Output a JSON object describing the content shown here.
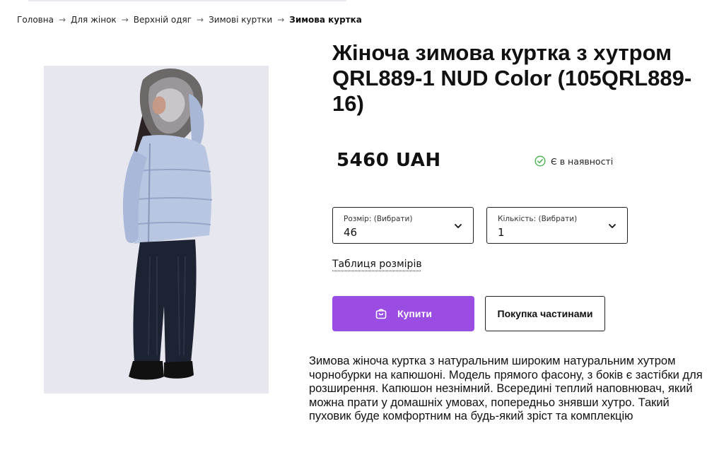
{
  "breadcrumb": {
    "items": [
      "Головна",
      "Для жінок",
      "Верхній одяг",
      "Зимові куртки"
    ],
    "current": "Зимова куртка",
    "separator": "→"
  },
  "product": {
    "title": "Жіноча зимова куртка з хутром QRL889-1 NUD Color (105QRL889-16)",
    "price": "5460 UAH",
    "stock_status": "Є в наявності",
    "image_icon": "product-photo"
  },
  "size_select": {
    "label": "Розмір: (Вибрати)",
    "value": "46"
  },
  "quantity_select": {
    "label": "Кількість: (Вибрати)",
    "value": "1"
  },
  "size_table_link": "Таблиця розмірів",
  "buttons": {
    "buy": "Купити",
    "installments": "Покупка частинами"
  },
  "description": "Зимова жіноча куртка з натуральним широким натуральним хутром чорнобурки на капюшоні. Модель прямого фасону, з боків є застібки для розширення. Капюшон незнімний.  Всередині теплий наповнювач, який можна прати у домашніх умовах, попередньо знявши хутро. Такий пуховик буде комфортним на будь-який зріст та комплекцію",
  "colors": {
    "accent": "#9b4de3",
    "stock_check": "#4caf50",
    "jacket": "#b8c6e2",
    "photo_bg": "#e7e7ef"
  }
}
